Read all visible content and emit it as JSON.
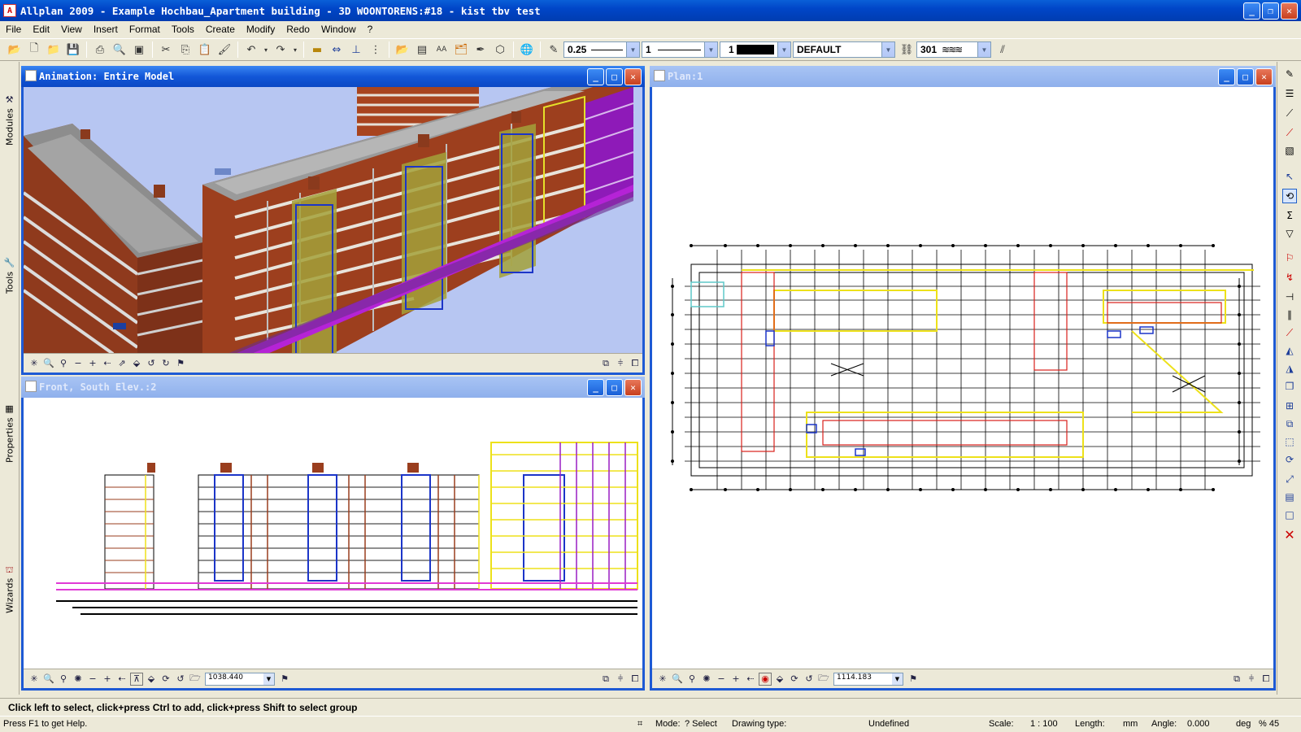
{
  "window": {
    "title": "Allplan 2009 - Example Hochbau_Apartment building - 3D  WOONTORENS:#18 - kist tbv test",
    "app_icon": "allplan-icon"
  },
  "menu": [
    "File",
    "Edit",
    "View",
    "Insert",
    "Format",
    "Tools",
    "Create",
    "Modify",
    "Redo",
    "Window",
    "?"
  ],
  "toolbar": {
    "pen_value": "0.25",
    "line_value": "1",
    "color_value": "1",
    "layer_value": "DEFAULT",
    "hatch_value": "301"
  },
  "left_dock": {
    "tabs": [
      "Modules",
      "Tools",
      "Properties",
      "Wizards"
    ]
  },
  "viewports": {
    "animation": {
      "title": "Animation: Entire Model"
    },
    "front": {
      "title": "Front, South Elev.:2",
      "zoom": "1038.440"
    },
    "plan": {
      "title": "Plan:1",
      "zoom": "1114.183"
    }
  },
  "hint": "Click left to select, click+press Ctrl to add, click+press Shift to select group",
  "status": {
    "help": "Press F1 to get Help.",
    "mode_label": "Mode:",
    "mode_value": "? Select",
    "drawing_type_label": "Drawing type:",
    "drawing_type_value": "Undefined",
    "scale_label": "Scale:",
    "scale_value": "1 : 100",
    "length_label": "Length:",
    "length_value": "mm",
    "angle_label": "Angle:",
    "angle_value": "0.000",
    "angle_unit": "deg",
    "percent": "% 45"
  },
  "colors": {
    "titlebar": "#0046c8",
    "sky": "#b7c6f2",
    "brick": "#9a3e1e",
    "highlight": "#f7f02a",
    "purple": "#9a1fc4"
  }
}
